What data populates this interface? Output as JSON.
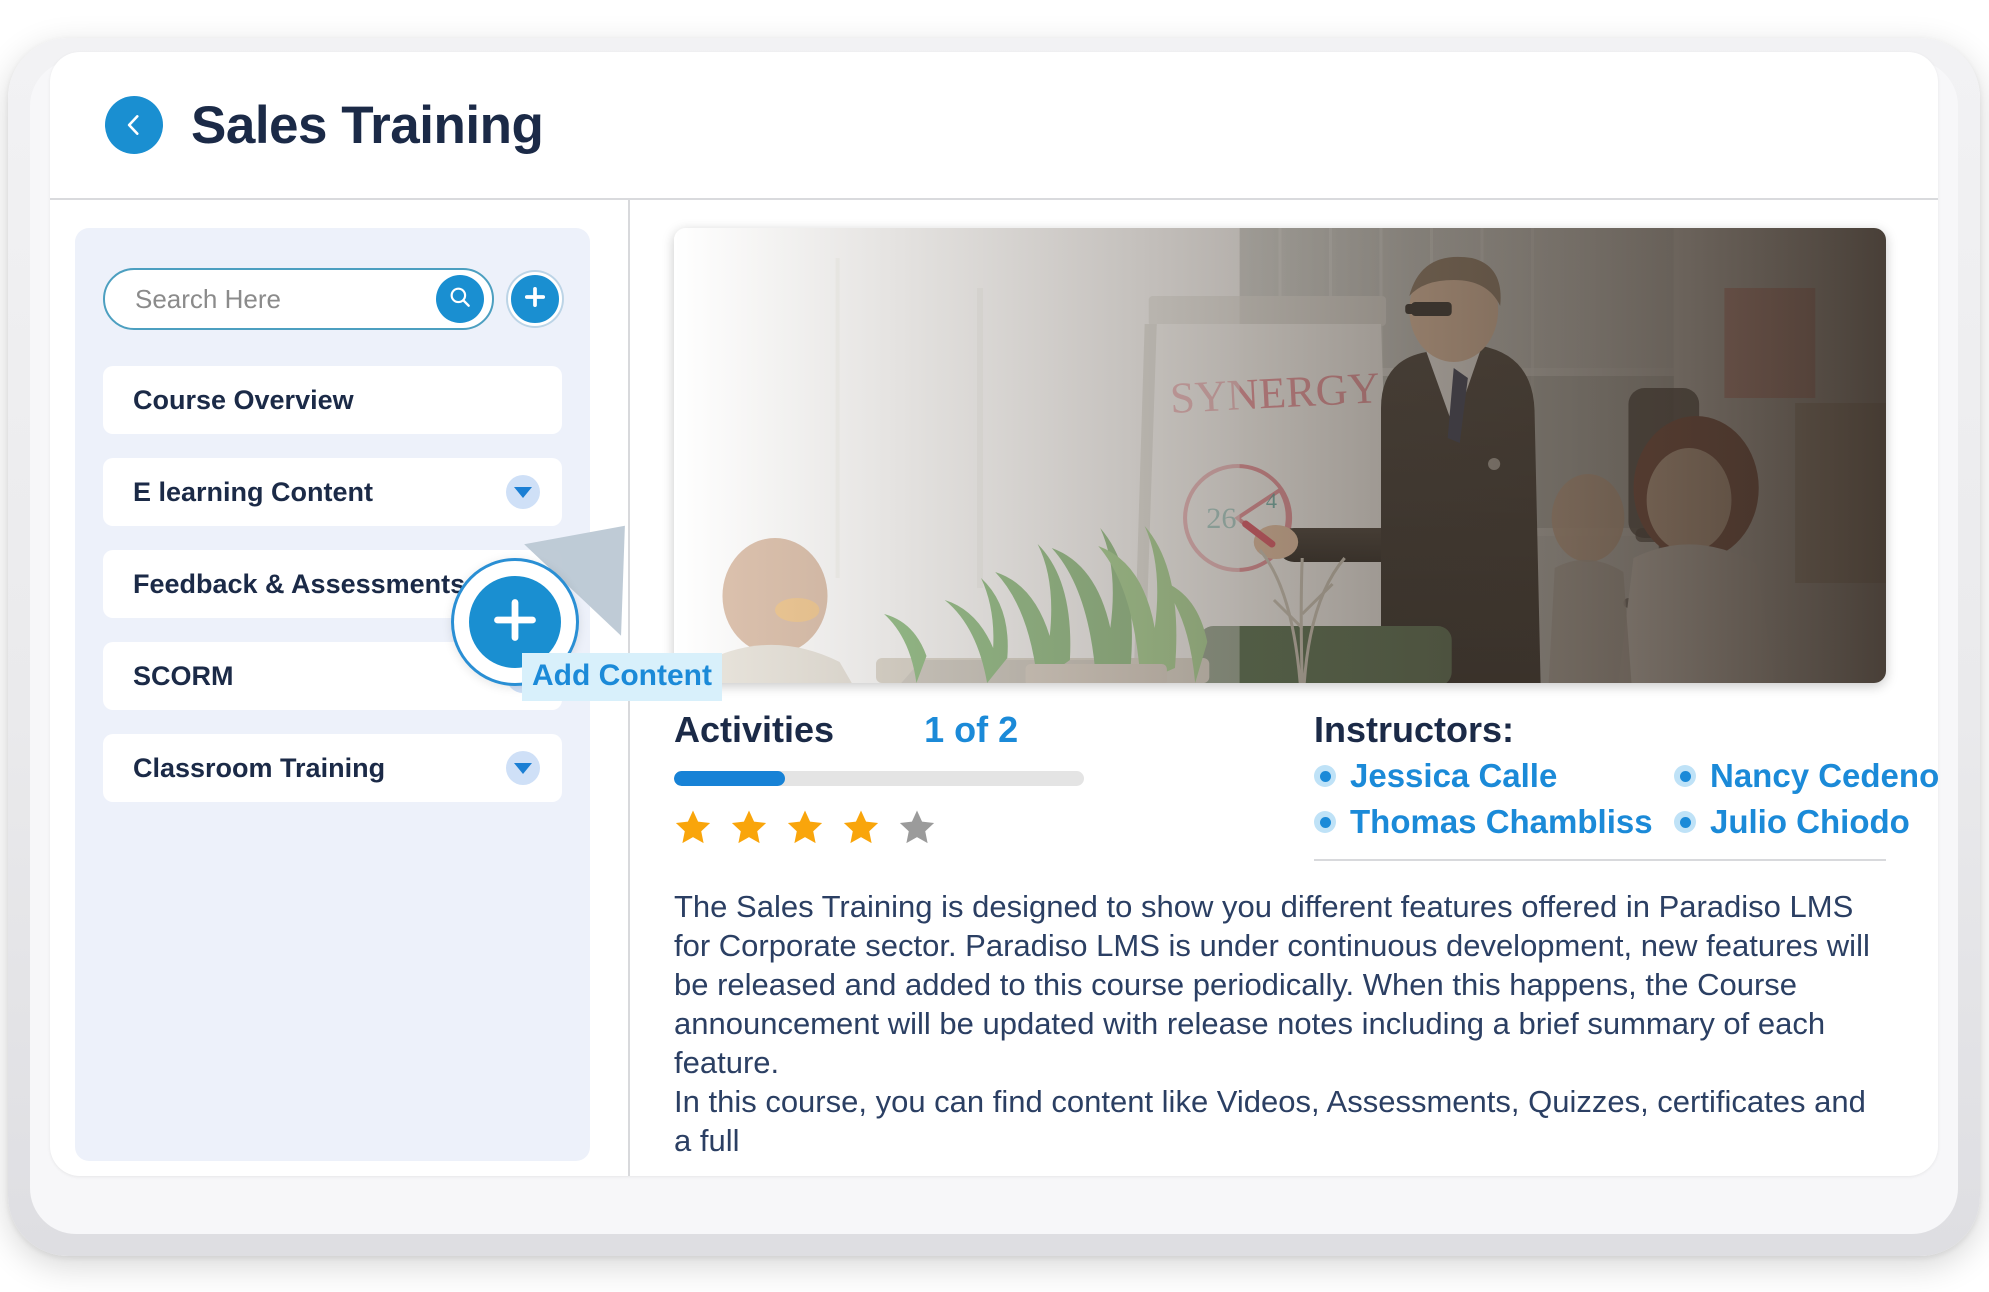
{
  "header": {
    "title": "Sales Training",
    "back_icon": "chevron-left-icon"
  },
  "sidebar": {
    "search": {
      "placeholder": "Search Here",
      "value": "",
      "search_icon": "search-icon"
    },
    "add_button": {
      "icon": "plus-icon",
      "label": "Add Content"
    },
    "items": [
      {
        "label": "Course Overview",
        "has_chevron": false
      },
      {
        "label": "E learning Content",
        "has_chevron": true
      },
      {
        "label": "Feedback & Assessments",
        "has_chevron": true
      },
      {
        "label": "SCORM",
        "has_chevron": true
      },
      {
        "label": "Classroom Training",
        "has_chevron": true
      }
    ]
  },
  "main": {
    "hero": {
      "alt": "Business trainer presenting at a flipchart with SYNERGY written in red and a pie chart, attendees seated in a bright office",
      "flipchart_text": "SYNERGY",
      "flipchart_number": "26"
    },
    "activities": {
      "title": "Activities",
      "count": "1 of 2",
      "progress_percent": 27,
      "rating_filled": 4,
      "rating_total": 5
    },
    "instructors": {
      "title": "Instructors:",
      "names": [
        "Jessica Calle",
        "Nancy Cedeno",
        "Thomas Chambliss",
        "Julio Chiodo"
      ]
    },
    "description": {
      "paragraph1": "The Sales Training is designed to show you different features offered in Paradiso LMS for Corporate sector. Paradiso LMS is under continuous development, new features will be released and added to this course periodically. When this happens, the Course announcement will be updated with release notes including a brief summary of each feature.",
      "paragraph2": "In this course, you can find content like Videos, Assessments, Quizzes, certificates and a full"
    }
  },
  "colors": {
    "accent_blue": "#1a8fd1",
    "link_blue": "#1b8ad8",
    "title_navy": "#1b2a47",
    "panel_bg": "#edf1fa",
    "star_gold": "#f9a50b",
    "star_gray": "#9b9b9b",
    "tooltip_bg": "#d8f0fb"
  }
}
